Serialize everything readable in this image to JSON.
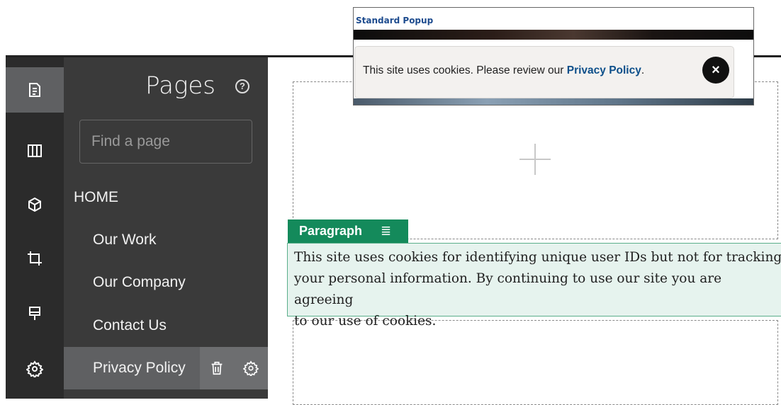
{
  "popup": {
    "title": "Standard Popup",
    "message": "This site uses cookies. Please review our ",
    "link_text": "Privacy Policy",
    "trailing": ".",
    "close_glyph": "×"
  },
  "rail": {
    "items": [
      {
        "icon": "pages-icon",
        "active": true
      },
      {
        "icon": "layout-columns-icon",
        "active": false
      },
      {
        "icon": "components-cube-icon",
        "active": false
      },
      {
        "icon": "crop-icon",
        "active": false
      },
      {
        "icon": "theme-brush-icon",
        "active": false
      },
      {
        "icon": "settings-gear-icon",
        "active": false
      }
    ]
  },
  "pages_panel": {
    "title": "Pages",
    "help_glyph": "?",
    "search_placeholder": "Find a page",
    "home_label": "HOME",
    "items": [
      "Our Work",
      "Our Company",
      "Contact Us",
      "Privacy Policy"
    ],
    "selected": "Privacy Policy"
  },
  "paragraph": {
    "tag_label": "Paragraph",
    "menu_glyph": "≣",
    "lines": [
      "This site uses cookies for identifying unique user IDs but not for tracking",
      "your personal information. By continuing to use our site you are agreeing",
      "to our use of cookies."
    ]
  },
  "colors": {
    "rail_bg": "#2b2b2b",
    "panel_bg": "#3a3a3a",
    "selected_bg": "#5f6062",
    "paragraph_tag": "#148a5b",
    "paragraph_bg": "#e6f3ee",
    "link": "#0d4f8a"
  }
}
